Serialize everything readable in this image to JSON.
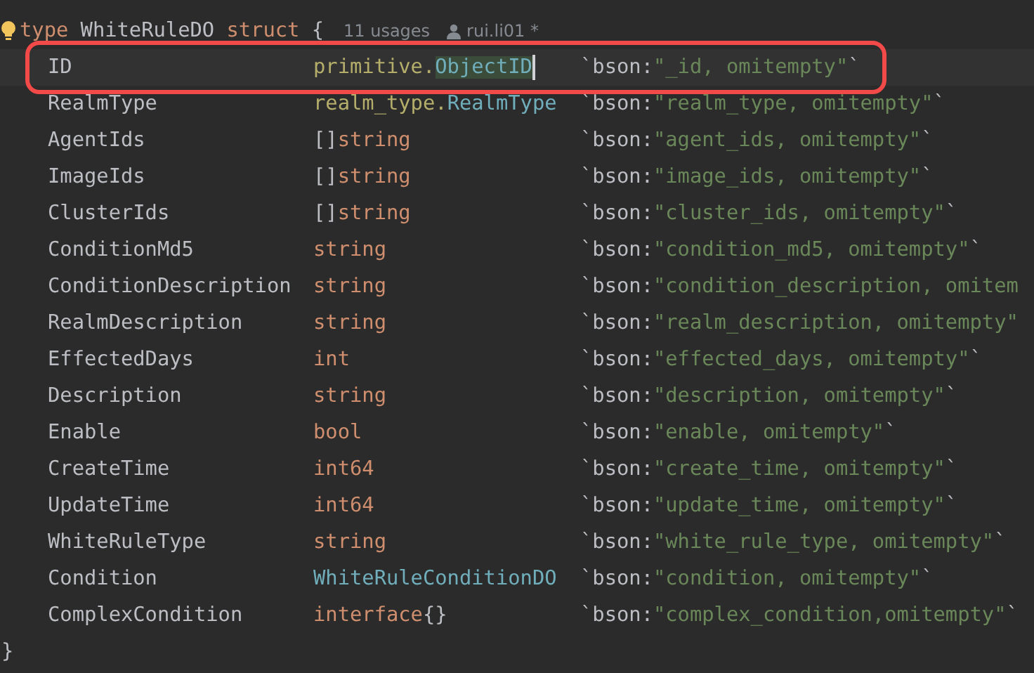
{
  "header": {
    "keyword": "type",
    "name": "WhiteRuleDO",
    "keyword2": "struct",
    "brace": "{",
    "usages": "11 usages",
    "author": "rui.li01 *"
  },
  "fields": [
    {
      "name": "ID",
      "current": true,
      "annotated": true,
      "type": [
        {
          "text": "primitive.",
          "kind": "package"
        },
        {
          "text": "ObjectID",
          "kind": "type",
          "highlighted": true,
          "cursor": true
        }
      ],
      "tag": [
        {
          "text": "`bson:",
          "kind": "punct"
        },
        {
          "text": "\"_id, omitempty\"",
          "kind": "string"
        },
        {
          "text": "`",
          "kind": "punct"
        }
      ]
    },
    {
      "name": "RealmType",
      "type": [
        {
          "text": "realm_type.",
          "kind": "package"
        },
        {
          "text": "RealmType",
          "kind": "type"
        }
      ],
      "tag": [
        {
          "text": "`bson:",
          "kind": "punct"
        },
        {
          "text": "\"realm_type, omitempty\"",
          "kind": "string"
        },
        {
          "text": "`",
          "kind": "punct"
        }
      ]
    },
    {
      "name": "AgentIds",
      "type": [
        {
          "text": "[]",
          "kind": "punct"
        },
        {
          "text": "string",
          "kind": "builtin"
        }
      ],
      "tag": [
        {
          "text": "`bson:",
          "kind": "punct"
        },
        {
          "text": "\"agent_ids, omitempty\"",
          "kind": "string"
        },
        {
          "text": "`",
          "kind": "punct"
        }
      ]
    },
    {
      "name": "ImageIds",
      "type": [
        {
          "text": "[]",
          "kind": "punct"
        },
        {
          "text": "string",
          "kind": "builtin"
        }
      ],
      "tag": [
        {
          "text": "`bson:",
          "kind": "punct"
        },
        {
          "text": "\"image_ids, omitempty\"",
          "kind": "string"
        },
        {
          "text": "`",
          "kind": "punct"
        }
      ]
    },
    {
      "name": "ClusterIds",
      "type": [
        {
          "text": "[]",
          "kind": "punct"
        },
        {
          "text": "string",
          "kind": "builtin"
        }
      ],
      "tag": [
        {
          "text": "`bson:",
          "kind": "punct"
        },
        {
          "text": "\"cluster_ids, omitempty\"",
          "kind": "string"
        },
        {
          "text": "`",
          "kind": "punct"
        }
      ]
    },
    {
      "name": "ConditionMd5",
      "type": [
        {
          "text": "string",
          "kind": "builtin"
        }
      ],
      "tag": [
        {
          "text": "`bson:",
          "kind": "punct"
        },
        {
          "text": "\"condition_md5, omitempty\"",
          "kind": "string"
        },
        {
          "text": "`",
          "kind": "punct"
        }
      ]
    },
    {
      "name": "ConditionDescription",
      "type": [
        {
          "text": "string",
          "kind": "builtin"
        }
      ],
      "tag": [
        {
          "text": "`bson:",
          "kind": "punct"
        },
        {
          "text": "\"condition_description, omitem",
          "kind": "string"
        }
      ]
    },
    {
      "name": "RealmDescription",
      "type": [
        {
          "text": "string",
          "kind": "builtin"
        }
      ],
      "tag": [
        {
          "text": "`bson:",
          "kind": "punct"
        },
        {
          "text": "\"realm_description, omitempty\"",
          "kind": "string"
        }
      ]
    },
    {
      "name": "EffectedDays",
      "type": [
        {
          "text": "int",
          "kind": "builtin"
        }
      ],
      "tag": [
        {
          "text": "`bson:",
          "kind": "punct"
        },
        {
          "text": "\"effected_days, omitempty\"",
          "kind": "string"
        },
        {
          "text": "`",
          "kind": "punct"
        }
      ]
    },
    {
      "name": "Description",
      "type": [
        {
          "text": "string",
          "kind": "builtin"
        }
      ],
      "tag": [
        {
          "text": "`bson:",
          "kind": "punct"
        },
        {
          "text": "\"description, omitempty\"",
          "kind": "string"
        },
        {
          "text": "`",
          "kind": "punct"
        }
      ]
    },
    {
      "name": "Enable",
      "type": [
        {
          "text": "bool",
          "kind": "builtin"
        }
      ],
      "tag": [
        {
          "text": "`bson:",
          "kind": "punct"
        },
        {
          "text": "\"enable, omitempty\"",
          "kind": "string"
        },
        {
          "text": "`",
          "kind": "punct"
        }
      ]
    },
    {
      "name": "CreateTime",
      "type": [
        {
          "text": "int64",
          "kind": "builtin"
        }
      ],
      "tag": [
        {
          "text": "`bson:",
          "kind": "punct"
        },
        {
          "text": "\"create_time, omitempty\"",
          "kind": "string"
        },
        {
          "text": "`",
          "kind": "punct"
        }
      ]
    },
    {
      "name": "UpdateTime",
      "type": [
        {
          "text": "int64",
          "kind": "builtin"
        }
      ],
      "tag": [
        {
          "text": "`bson:",
          "kind": "punct"
        },
        {
          "text": "\"update_time, omitempty\"",
          "kind": "string"
        },
        {
          "text": "`",
          "kind": "punct"
        }
      ]
    },
    {
      "name": "WhiteRuleType",
      "type": [
        {
          "text": "string",
          "kind": "builtin"
        }
      ],
      "tag": [
        {
          "text": "`bson:",
          "kind": "punct"
        },
        {
          "text": "\"white_rule_type, omitempty\"",
          "kind": "string"
        },
        {
          "text": "`",
          "kind": "punct"
        }
      ]
    },
    {
      "name": "Condition",
      "type": [
        {
          "text": "WhiteRuleConditionDO",
          "kind": "type"
        }
      ],
      "tag": [
        {
          "text": "`bson:",
          "kind": "punct"
        },
        {
          "text": "\"condition, omitempty\"",
          "kind": "string"
        },
        {
          "text": "`",
          "kind": "punct"
        }
      ]
    },
    {
      "name": "ComplexCondition",
      "type": [
        {
          "text": "interface",
          "kind": "builtin"
        },
        {
          "text": "{}",
          "kind": "punct"
        }
      ],
      "tag": [
        {
          "text": "`bson:",
          "kind": "punct"
        },
        {
          "text": "\"complex_condition,omitempty\"",
          "kind": "string"
        },
        {
          "text": "`",
          "kind": "punct"
        }
      ]
    }
  ],
  "closing_brace": "}"
}
